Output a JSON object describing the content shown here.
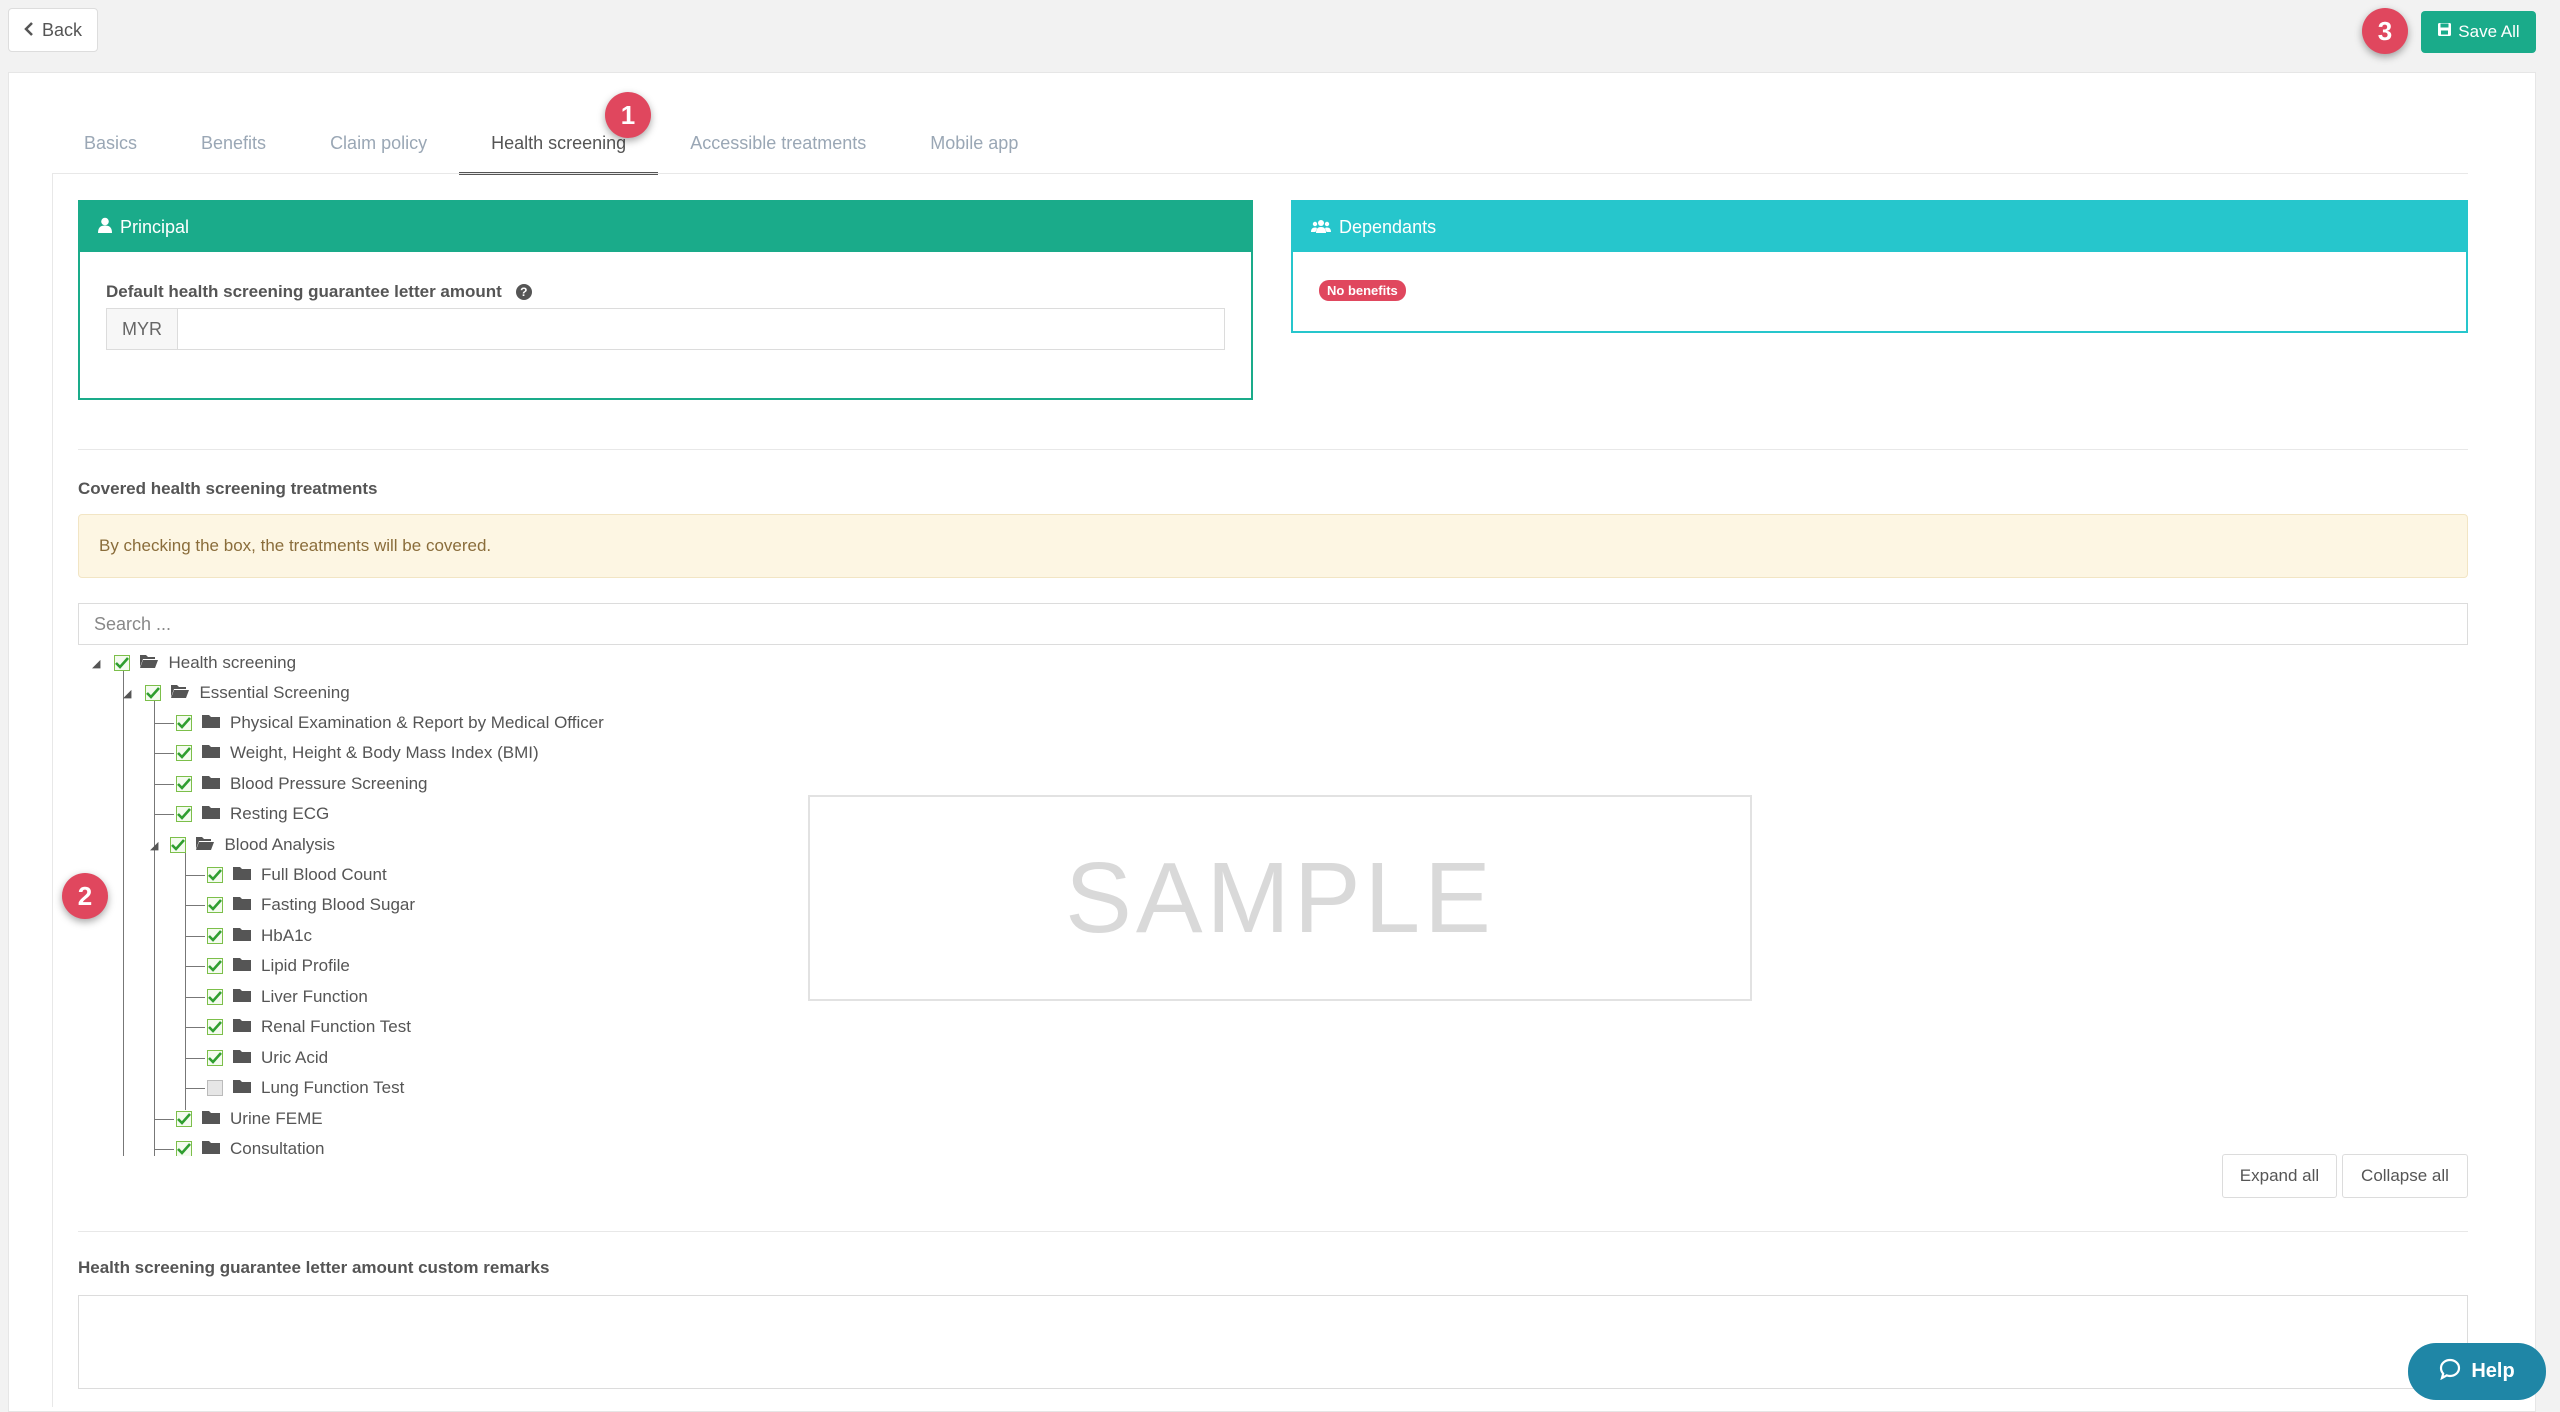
{
  "topbar": {
    "back_label": "Back",
    "save_label": "Save All"
  },
  "steps": [
    "1",
    "2",
    "3"
  ],
  "tabs": [
    {
      "label": "Basics",
      "active": false
    },
    {
      "label": "Benefits",
      "active": false
    },
    {
      "label": "Claim policy",
      "active": false
    },
    {
      "label": "Health screening",
      "active": true
    },
    {
      "label": "Accessible treatments",
      "active": false
    },
    {
      "label": "Mobile app",
      "active": false
    }
  ],
  "principal": {
    "title": "Principal",
    "field_label": "Default health screening guarantee letter amount",
    "currency": "MYR",
    "amount_value": ""
  },
  "dependants": {
    "title": "Dependants",
    "badge": "No benefits"
  },
  "covered": {
    "title": "Covered health screening treatments",
    "alert": "By checking the box, the treatments will be covered.",
    "search_placeholder": "Search ..."
  },
  "tree": [
    {
      "label": "Health screening",
      "checked": true
    },
    {
      "label": "Essential Screening",
      "checked": true
    },
    {
      "label": "Physical Examination & Report by Medical Officer",
      "checked": true
    },
    {
      "label": "Weight, Height & Body Mass Index (BMI)",
      "checked": true
    },
    {
      "label": "Blood Pressure Screening",
      "checked": true
    },
    {
      "label": "Resting ECG",
      "checked": true
    },
    {
      "label": "Blood Analysis",
      "checked": true
    },
    {
      "label": "Full Blood Count",
      "checked": true
    },
    {
      "label": "Fasting Blood Sugar",
      "checked": true
    },
    {
      "label": "HbA1c",
      "checked": true
    },
    {
      "label": "Lipid Profile",
      "checked": true
    },
    {
      "label": "Liver Function",
      "checked": true
    },
    {
      "label": "Renal Function Test",
      "checked": true
    },
    {
      "label": "Uric Acid",
      "checked": true
    },
    {
      "label": "Lung Function Test",
      "checked": false
    },
    {
      "label": "Urine FEME",
      "checked": true
    },
    {
      "label": "Consultation",
      "checked": true
    }
  ],
  "sample_watermark": "SAMPLE",
  "tree_actions": {
    "expand_all": "Expand all",
    "collapse_all": "Collapse all"
  },
  "remarks": {
    "title": "Health screening guarantee letter amount custom remarks",
    "value": ""
  },
  "help_label": "Help",
  "colors": {
    "primary": "#1aab8a",
    "info": "#26c6cc",
    "danger": "#e0475e",
    "help": "#1f86a6"
  }
}
